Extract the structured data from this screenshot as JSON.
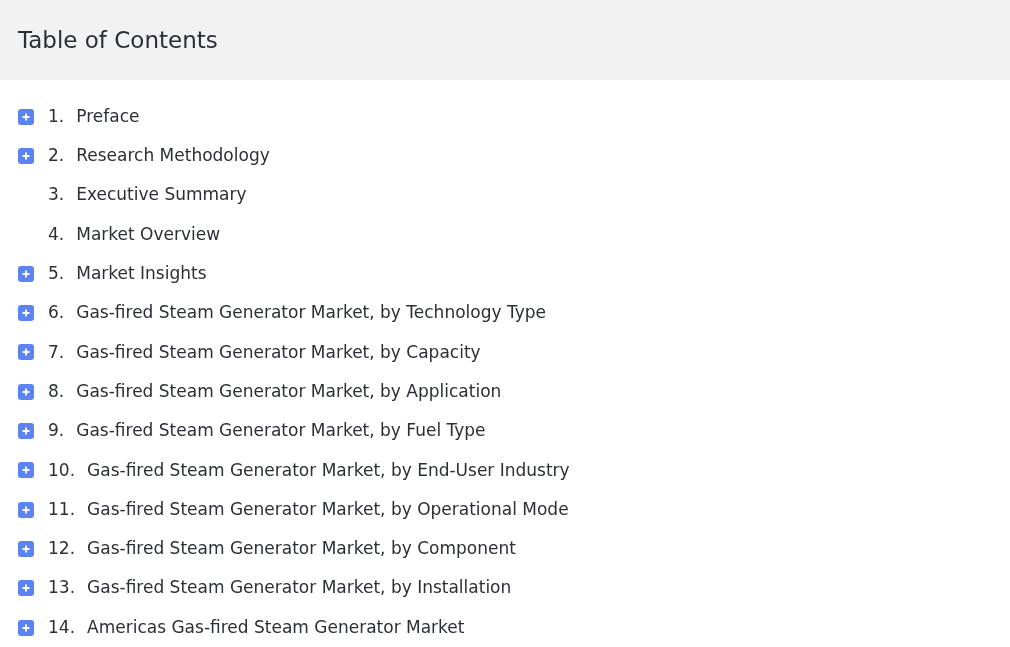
{
  "header": {
    "title": "Table of Contents"
  },
  "items": [
    {
      "number": "1.",
      "title": "Preface",
      "expandable": true
    },
    {
      "number": "2.",
      "title": "Research Methodology",
      "expandable": true
    },
    {
      "number": "3.",
      "title": "Executive Summary",
      "expandable": false
    },
    {
      "number": "4.",
      "title": "Market Overview",
      "expandable": false
    },
    {
      "number": "5.",
      "title": "Market Insights",
      "expandable": true
    },
    {
      "number": "6.",
      "title": "Gas-fired Steam Generator Market, by Technology Type",
      "expandable": true
    },
    {
      "number": "7.",
      "title": "Gas-fired Steam Generator Market, by Capacity",
      "expandable": true
    },
    {
      "number": "8.",
      "title": "Gas-fired Steam Generator Market, by Application",
      "expandable": true
    },
    {
      "number": "9.",
      "title": "Gas-fired Steam Generator Market, by Fuel Type",
      "expandable": true
    },
    {
      "number": "10.",
      "title": "Gas-fired Steam Generator Market, by End-User Industry",
      "expandable": true
    },
    {
      "number": "11.",
      "title": "Gas-fired Steam Generator Market, by Operational Mode",
      "expandable": true
    },
    {
      "number": "12.",
      "title": "Gas-fired Steam Generator Market, by Component",
      "expandable": true
    },
    {
      "number": "13.",
      "title": "Gas-fired Steam Generator Market, by Installation",
      "expandable": true
    },
    {
      "number": "14.",
      "title": "Americas Gas-fired Steam Generator Market",
      "expandable": true
    }
  ]
}
